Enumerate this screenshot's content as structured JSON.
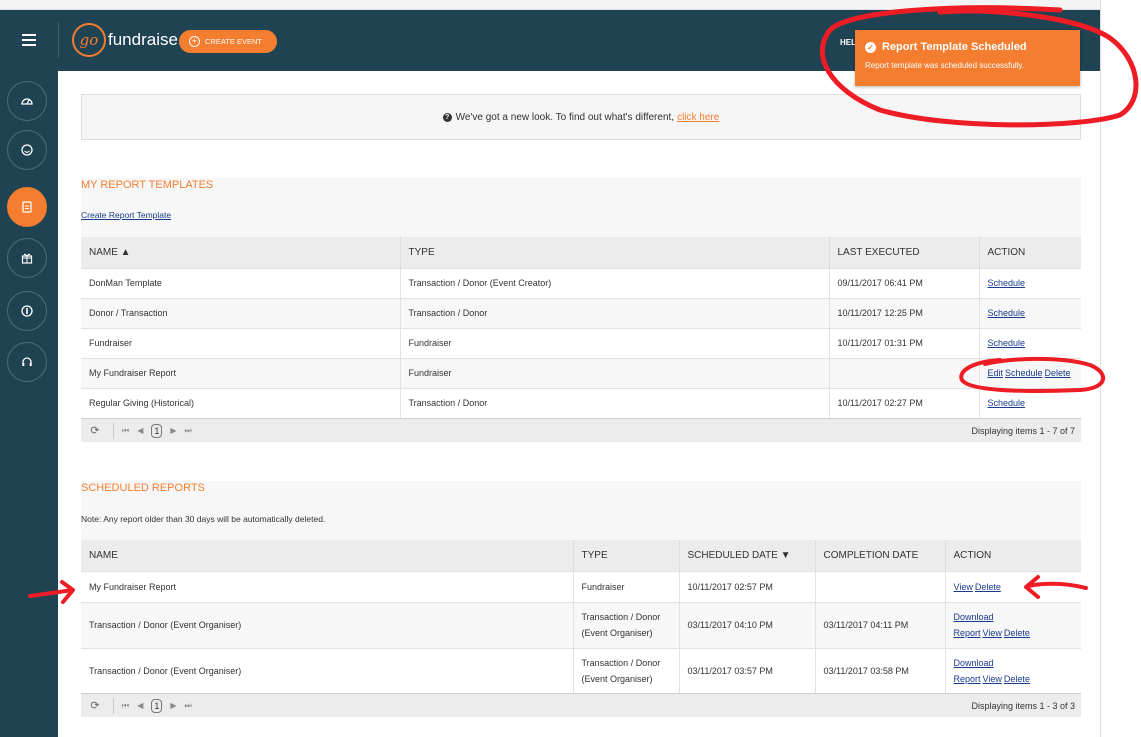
{
  "header": {
    "logo_go": "go",
    "logo_text": "fundraise",
    "create_event": "CREATE EVENT",
    "help": "HEL"
  },
  "sidebar": {
    "items": [
      {
        "icon": "dashboard-icon"
      },
      {
        "icon": "smiley-icon"
      },
      {
        "icon": "reports-icon",
        "active": true
      },
      {
        "icon": "gift-icon"
      },
      {
        "icon": "donation-icon"
      },
      {
        "icon": "headset-icon"
      }
    ]
  },
  "toast": {
    "title": "Report Template Scheduled",
    "message": "Report template was scheduled successfully."
  },
  "notice": {
    "text": "We've got a new look. To find out what's different,",
    "link": "click here"
  },
  "templates": {
    "title": "MY REPORT TEMPLATES",
    "create_link": "Create Report Template",
    "columns": [
      "NAME ▲",
      "TYPE",
      "LAST EXECUTED",
      "ACTION"
    ],
    "rows": [
      {
        "name": "DonMan Template",
        "type": "Transaction / Donor (Event Creator)",
        "last": "09/11/2017 06:41 PM",
        "actions": [
          "Schedule"
        ]
      },
      {
        "name": "Donor / Transaction",
        "type": "Transaction / Donor",
        "last": "10/11/2017 12:25 PM",
        "actions": [
          "Schedule"
        ]
      },
      {
        "name": "Fundraiser",
        "type": "Fundraiser",
        "last": "10/11/2017 01:31 PM",
        "actions": [
          "Schedule"
        ]
      },
      {
        "name": "My Fundraiser Report",
        "type": "Fundraiser",
        "last": "",
        "actions": [
          "Edit",
          "Schedule",
          "Delete"
        ]
      },
      {
        "name": "Regular Giving (Historical)",
        "type": "Transaction / Donor",
        "last": "10/11/2017 02:27 PM",
        "actions": [
          "Schedule"
        ]
      }
    ],
    "pager": {
      "page": "1",
      "info": "Displaying items 1 - 7 of 7"
    }
  },
  "scheduled": {
    "title": "SCHEDULED REPORTS",
    "note": "Note: Any report older than 30 days will be automatically deleted.",
    "columns": [
      "NAME",
      "TYPE",
      "SCHEDULED DATE ▼",
      "COMPLETION DATE",
      "ACTION"
    ],
    "rows": [
      {
        "name": "My Fundraiser Report",
        "type": "Fundraiser",
        "scheduled": "10/11/2017 02:57 PM",
        "completed": "",
        "actions": [
          "View",
          "Delete"
        ]
      },
      {
        "name": "Transaction / Donor (Event Organiser)",
        "type": "Transaction / Donor (Event Organiser)",
        "scheduled": "03/11/2017 04:10 PM",
        "completed": "03/11/2017 04:11 PM",
        "actions": [
          "Download Report",
          "View",
          "Delete"
        ]
      },
      {
        "name": "Transaction / Donor (Event Organiser)",
        "type": "Transaction / Donor (Event Organiser)",
        "scheduled": "03/11/2017 03:57 PM",
        "completed": "03/11/2017 03:58 PM",
        "actions": [
          "Download Report",
          "View",
          "Delete"
        ]
      }
    ],
    "pager": {
      "page": "1",
      "info": "Displaying items 1 - 3 of 3"
    }
  },
  "colors": {
    "accent": "#f47d30",
    "header": "#1f4352",
    "link": "#1a3a8c",
    "annotation": "#ee1c25"
  }
}
